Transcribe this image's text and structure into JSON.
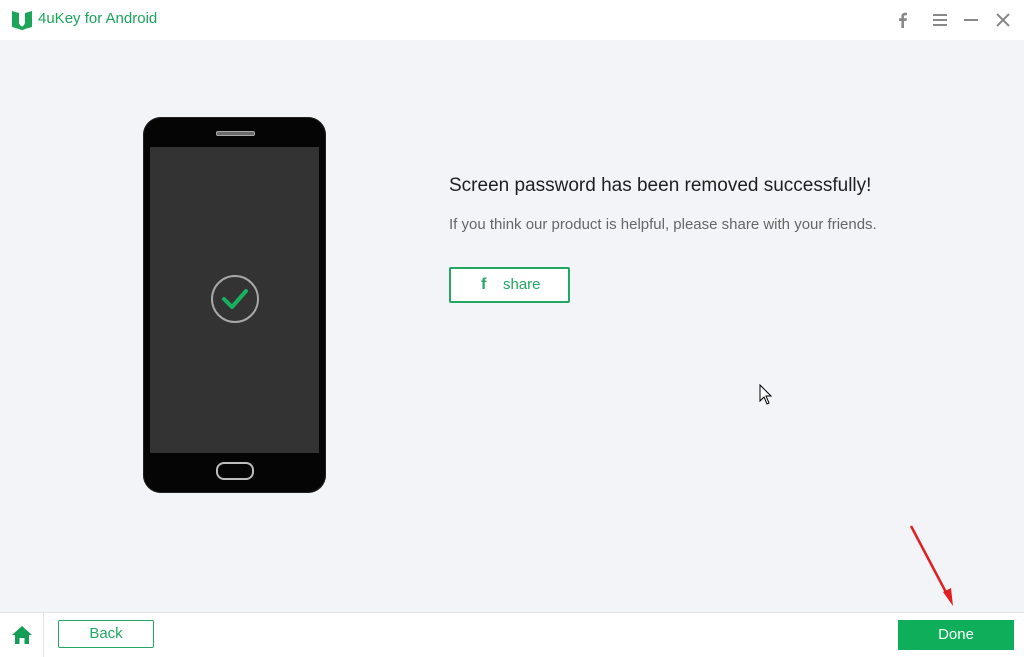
{
  "app": {
    "title": "4uKey for Android",
    "brand_color": "#1aa55a"
  },
  "titlebar": {
    "icons": [
      "facebook-icon",
      "menu-icon",
      "minimize-icon",
      "close-icon"
    ]
  },
  "result": {
    "title": "Screen password has been removed successfully!",
    "subtitle": "If you think our product is helpful, please share with your friends.",
    "share_icon_text": "f",
    "share_label": "share",
    "status_icon": "check-icon"
  },
  "footer": {
    "home_icon": "home-icon",
    "back_label": "Back",
    "done_label": "Done",
    "accent_color": "#0fae5a"
  },
  "annotation": {
    "arrow_color": "#e02020"
  }
}
